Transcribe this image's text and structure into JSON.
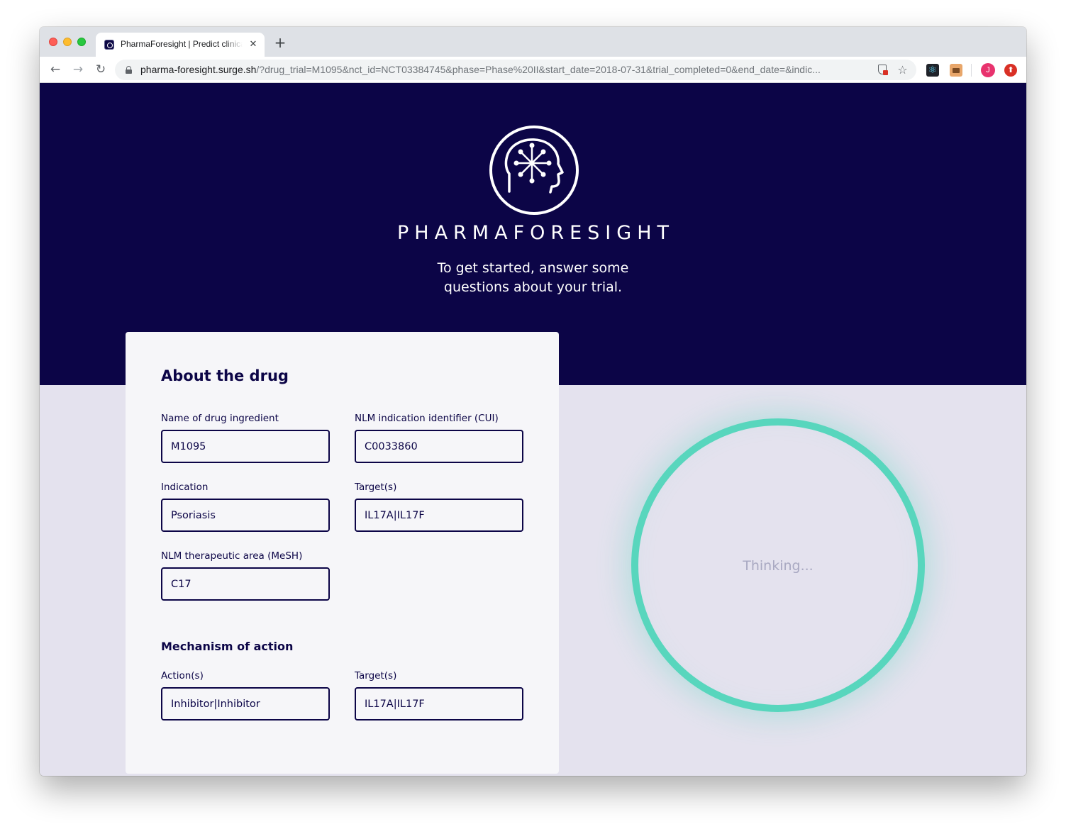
{
  "browser": {
    "tab_title": "PharmaForesight | Predict clinical trial",
    "url_host": "pharma-foresight.surge.sh",
    "url_rest": "/?drug_trial=M1095&nct_id=NCT03384745&phase=Phase%20II&start_date=2018-07-31&trial_completed=0&end_date=&indic...",
    "profile_initial": "J",
    "icons": {
      "back": "←",
      "forward": "→",
      "reload": "↻",
      "close": "✕",
      "new_tab": "+",
      "star": "☆",
      "update": "⬆"
    }
  },
  "hero": {
    "brand": "PHARMAFORESIGHT",
    "tagline_line1": "To get started, answer some",
    "tagline_line2": "questions about your trial."
  },
  "form": {
    "about_title": "About the drug",
    "fields": {
      "drug_ingredient": {
        "label": "Name of drug ingredient",
        "value": "M1095"
      },
      "cui": {
        "label": "NLM indication identifier (CUI)",
        "value": "C0033860"
      },
      "indication": {
        "label": "Indication",
        "value": "Psoriasis"
      },
      "targets": {
        "label": "Target(s)",
        "value": "IL17A|IL17F"
      },
      "therapeutic_area": {
        "label": "NLM therapeutic area (MeSH)",
        "value": "C17"
      }
    },
    "moa_title": "Mechanism of action",
    "moa_fields": {
      "actions": {
        "label": "Action(s)",
        "value": "Inhibitor|Inhibitor"
      },
      "targets": {
        "label": "Target(s)",
        "value": "IL17A|IL17F"
      }
    }
  },
  "status": {
    "thinking": "Thinking..."
  },
  "colors": {
    "brand_navy": "#0c0547",
    "accent_teal": "#58d6bd",
    "page_bg": "#e4e2ee",
    "card_bg": "#f6f6f9"
  }
}
